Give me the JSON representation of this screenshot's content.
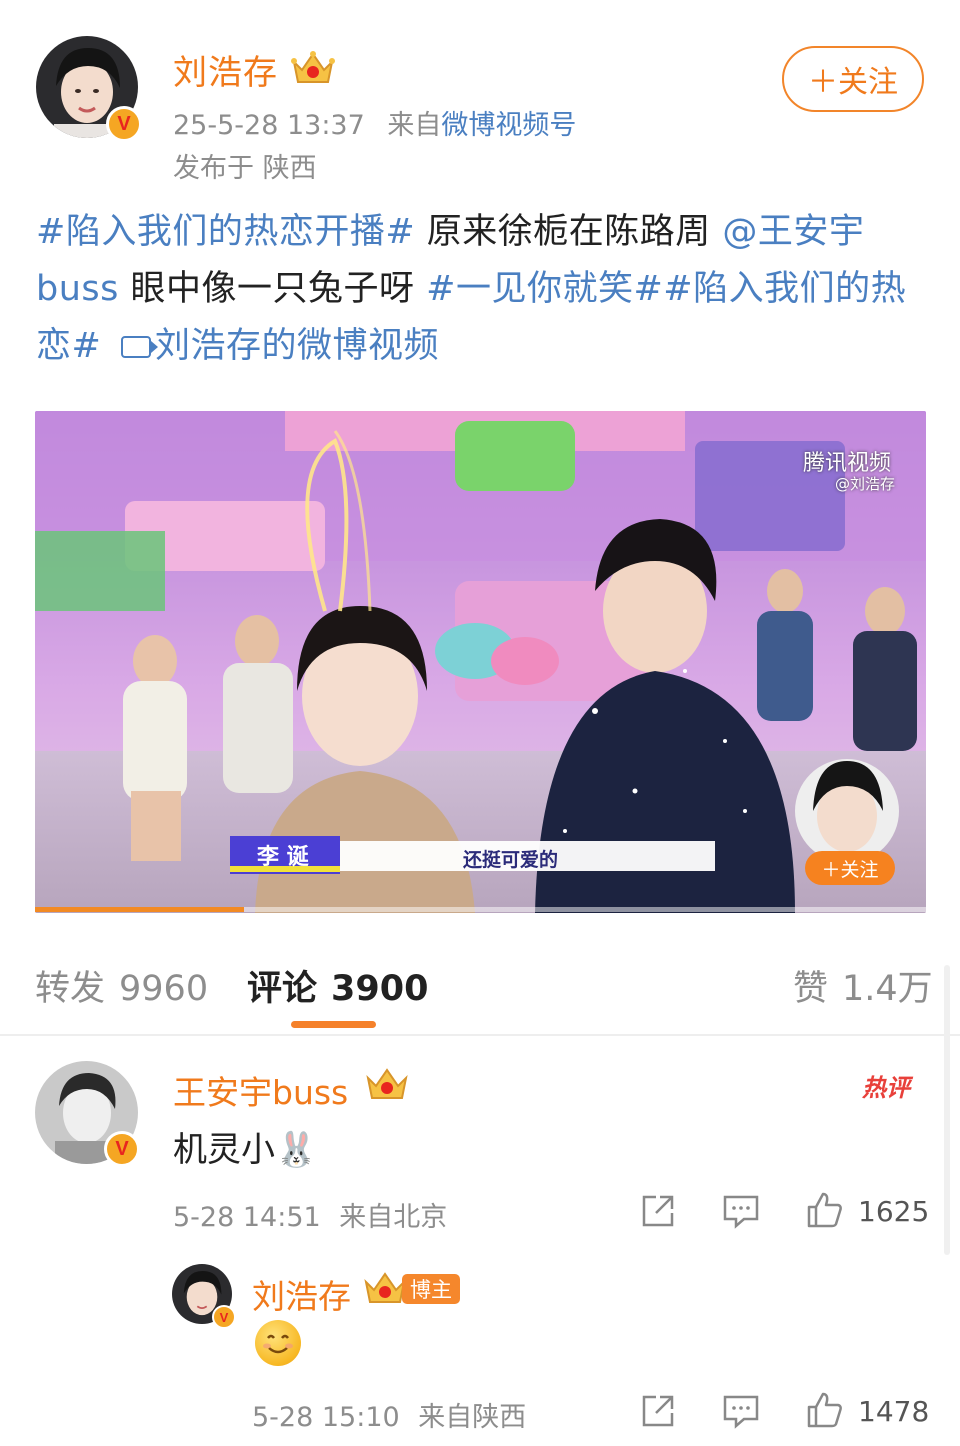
{
  "post": {
    "author": "刘浩存",
    "time": "25-5-28 13:37",
    "source_prefix": "来自",
    "source": "微博视频号",
    "location": "发布于 陕西",
    "follow_label": "＋关注",
    "text": {
      "tag1": "#陷入我们的热恋开播#",
      "body1": " 原来徐栀在陈路周 ",
      "mention": "@王安宇buss",
      "body2": " 眼中像一只兔子呀 ",
      "tag2": "#一见你就笑##陷入我们的热恋#",
      "video_link": "刘浩存的微博视频"
    }
  },
  "video": {
    "subtitle_name": "李 诞",
    "subtitle_text": "还挺可爱的",
    "watermark": "腾讯视频",
    "watermark_handle": "@刘浩存",
    "overlay_follow": "＋关注",
    "progress": 0.235
  },
  "tabs": [
    {
      "label": "转发",
      "count": "9960",
      "active": false
    },
    {
      "label": "评论",
      "count": "3900",
      "active": true
    },
    {
      "label": "赞",
      "count": "1.4万",
      "active": false
    }
  ],
  "comments": [
    {
      "user": "王安宇buss",
      "hot_label": "热评",
      "text": "机灵小🐰",
      "time": "5-28 14:51",
      "from": "来自北京",
      "likes": "1625"
    },
    {
      "user": "刘浩存",
      "owner_tag": "博主",
      "time": "5-28 15:10",
      "from": "来自陕西",
      "likes": "1478"
    }
  ],
  "icons": [
    "verified-v-icon",
    "crown-badge-icon",
    "video-link-icon",
    "share-icon",
    "comment-icon",
    "like-icon",
    "smile-emoji"
  ],
  "colors": {
    "accent": "#f07a1c",
    "link": "#4a7fc1",
    "hot": "#e8403a",
    "muted": "#8d8d8d"
  }
}
